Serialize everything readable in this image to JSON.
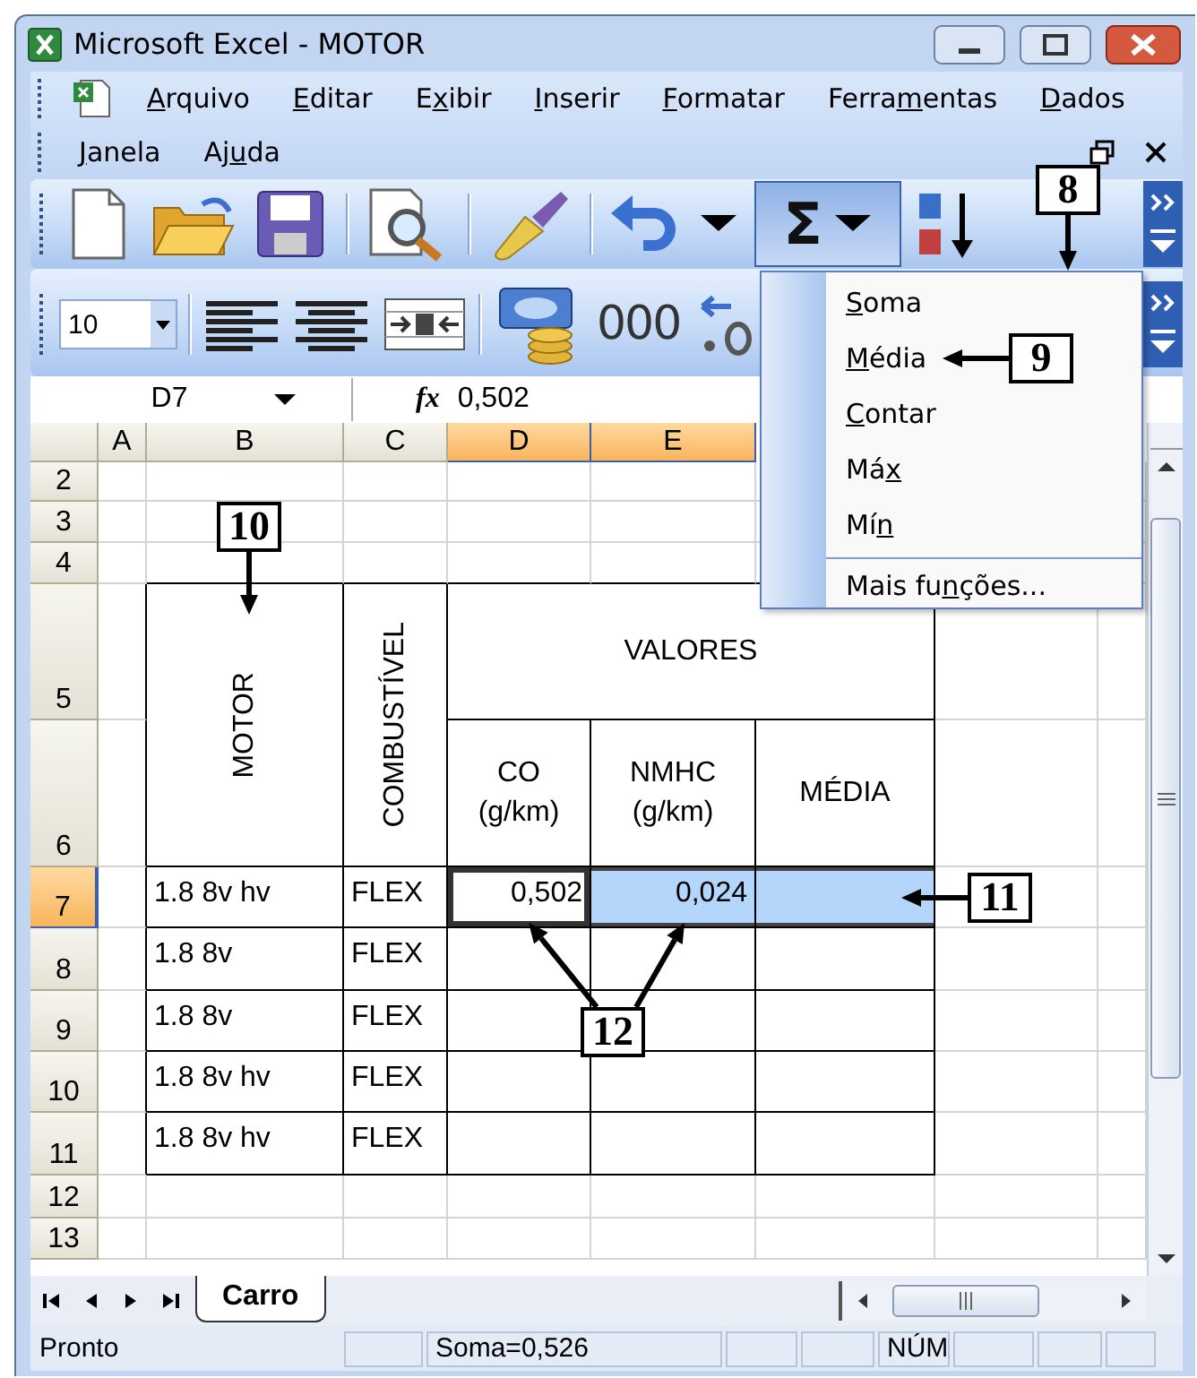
{
  "window": {
    "title": "Microsoft Excel - MOTOR"
  },
  "menu_bar": {
    "rows": [
      [
        {
          "key": "A",
          "rest": "rquivo"
        },
        {
          "key": "E",
          "rest": "ditar"
        },
        {
          "pre": "E",
          "key": "x",
          "rest": "ibir"
        },
        {
          "key": "I",
          "rest": "nserir"
        },
        {
          "key": "F",
          "rest": "ormatar"
        },
        {
          "pre": "Ferra",
          "key": "m",
          "rest": "entas"
        },
        {
          "key": "D",
          "rest": "ados"
        }
      ],
      [
        {
          "key": "J",
          "rest": "anela"
        },
        {
          "pre": "Aj",
          "key": "u",
          "rest": "da"
        }
      ]
    ]
  },
  "standard_toolbar": {
    "autosum": {
      "symbol": "Σ",
      "pressed": true
    }
  },
  "formatting_toolbar": {
    "font_size": "10",
    "thousands": "000"
  },
  "formula_bar": {
    "name_box": "D7",
    "fx": "fx",
    "value": "0,502"
  },
  "autosum_menu": {
    "items": [
      {
        "key": "S",
        "rest": "oma",
        "separator_before": false
      },
      {
        "key": "M",
        "rest": "édia",
        "separator_before": false
      },
      {
        "key": "C",
        "rest": "ontar",
        "separator_before": false
      },
      {
        "pre": "Má",
        "key": "x",
        "separator_before": false
      },
      {
        "pre": "Mí",
        "key": "n",
        "separator_before": false
      },
      {
        "pre": "Mais fu",
        "key": "n",
        "rest": "ções...",
        "separator_before": true
      }
    ]
  },
  "sheet": {
    "columns": [
      {
        "label": "A",
        "selected": false
      },
      {
        "label": "B",
        "selected": false
      },
      {
        "label": "C",
        "selected": false
      },
      {
        "label": "D",
        "selected": true
      },
      {
        "label": "E",
        "selected": true
      }
    ],
    "rows": [
      {
        "label": "2",
        "selected": false
      },
      {
        "label": "3",
        "selected": false
      },
      {
        "label": "4",
        "selected": false
      },
      {
        "label": "5",
        "selected": false
      },
      {
        "label": "6",
        "selected": false
      },
      {
        "label": "7",
        "selected": true
      },
      {
        "label": "8",
        "selected": false
      },
      {
        "label": "9",
        "selected": false
      },
      {
        "label": "10",
        "selected": false
      },
      {
        "label": "11",
        "selected": false
      },
      {
        "label": "12",
        "selected": false
      },
      {
        "label": "13",
        "selected": false
      }
    ],
    "header_block": {
      "motor": "MOTOR",
      "fuel": "COMBUSTÍVEL",
      "values": "VALORES",
      "columns": [
        "CO\n(g/km)",
        "NMHC\n(g/km)",
        "MÉDIA"
      ]
    },
    "data_rows": [
      {
        "cells": [
          {
            "text": "1.8 8v hv",
            "selected": false,
            "active": false
          },
          {
            "text": "FLEX",
            "selected": false,
            "active": false
          },
          {
            "text": "0,502",
            "selected": true,
            "active": true
          },
          {
            "text": "0,024",
            "selected": true,
            "active": false
          },
          {
            "selected": true,
            "active": false
          }
        ]
      },
      {
        "cells": [
          {
            "text": "1.8 8v",
            "selected": false,
            "active": false
          },
          {
            "text": "FLEX",
            "selected": false,
            "active": false
          }
        ]
      },
      {
        "cells": [
          {
            "text": "1.8 8v",
            "selected": false,
            "active": false
          },
          {
            "text": "FLEX",
            "selected": false,
            "active": false
          }
        ]
      },
      {
        "cells": [
          {
            "text": "1.8 8v hv",
            "selected": false,
            "active": false
          },
          {
            "text": "FLEX",
            "selected": false,
            "active": false
          }
        ]
      },
      {
        "cells": [
          {
            "text": "1.8 8v hv",
            "selected": false,
            "active": false
          },
          {
            "text": "FLEX",
            "selected": false,
            "active": false
          }
        ]
      }
    ]
  },
  "sheet_tabs": [
    {
      "label": "Carro",
      "selected": true
    }
  ],
  "status_bar": {
    "mode": "Pronto",
    "sum": "Soma=0,526",
    "num_lock": "NÚM"
  },
  "callouts": [
    {
      "number": "8"
    },
    {
      "number": "9"
    },
    {
      "number": "10"
    },
    {
      "number": "11"
    },
    {
      "number": "12"
    }
  ]
}
